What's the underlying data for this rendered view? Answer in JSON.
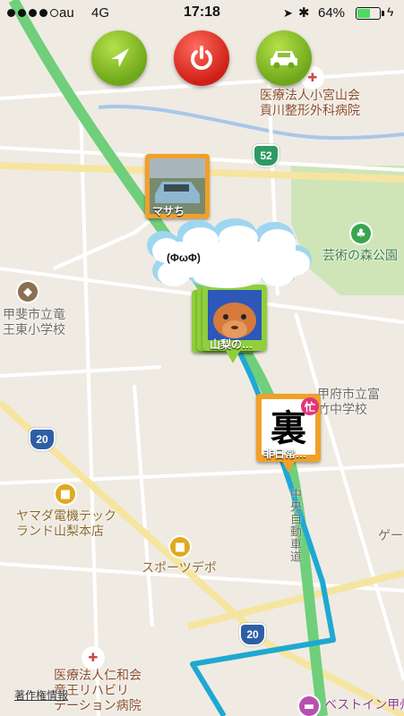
{
  "status_bar": {
    "carrier": "au",
    "network": "4G",
    "time": "17:18",
    "battery_percent": "64%",
    "battery_level": 0.64,
    "icons": [
      "signal-dots-icon",
      "location-arrow-icon",
      "bluetooth-icon",
      "battery-icon",
      "charging-bolt-icon"
    ]
  },
  "toolbar": {
    "buttons": [
      {
        "name": "location-button",
        "icon": "navigation-arrow-icon"
      },
      {
        "name": "power-button",
        "icon": "power-icon"
      },
      {
        "name": "car-button",
        "icon": "car-icon"
      }
    ]
  },
  "map": {
    "labels": {
      "hospital_1": "医療法人小宮山会",
      "hospital_1b": "貢川整形外科病院",
      "park": "芸術の森公園",
      "school_1": "甲斐市立竜",
      "school_1b": "王東小学校",
      "school_2": "甲府市立富",
      "school_2b": "竹中学校",
      "store": "ヤマダ電機テック",
      "store_b": "ランド山梨本店",
      "sports": "スポーツデポ",
      "hospital_2": "医療法人仁和会",
      "hospital_2b": "竜王リハビリ",
      "hospital_2c": "テーション病院",
      "hotel": "ベストイン甲州",
      "partial": "ゲート",
      "road": "中央自動車道"
    },
    "route_shields": [
      "52",
      "20",
      "20"
    ],
    "colors": {
      "background": "#efebe3",
      "park": "#cfe5b8",
      "river": "#a9c7e8",
      "expressway": "#6fcf7a",
      "track": "#1fa8d2"
    }
  },
  "pins": [
    {
      "name": "pin-masachi",
      "label": "マサち",
      "frame_color": "#f0a02a"
    },
    {
      "name": "pin-yamanashi",
      "label": "山梨の…",
      "frame_color": "#8fcf3c"
    },
    {
      "name": "pin-hinichijou",
      "label": "非日常…",
      "frame_color": "#f0a02a",
      "kanji": "裏",
      "badge": "忙"
    }
  ],
  "speech_bubble": {
    "text": "(ΦωΦ)"
  },
  "footer": {
    "copyright": "著作権情報"
  }
}
